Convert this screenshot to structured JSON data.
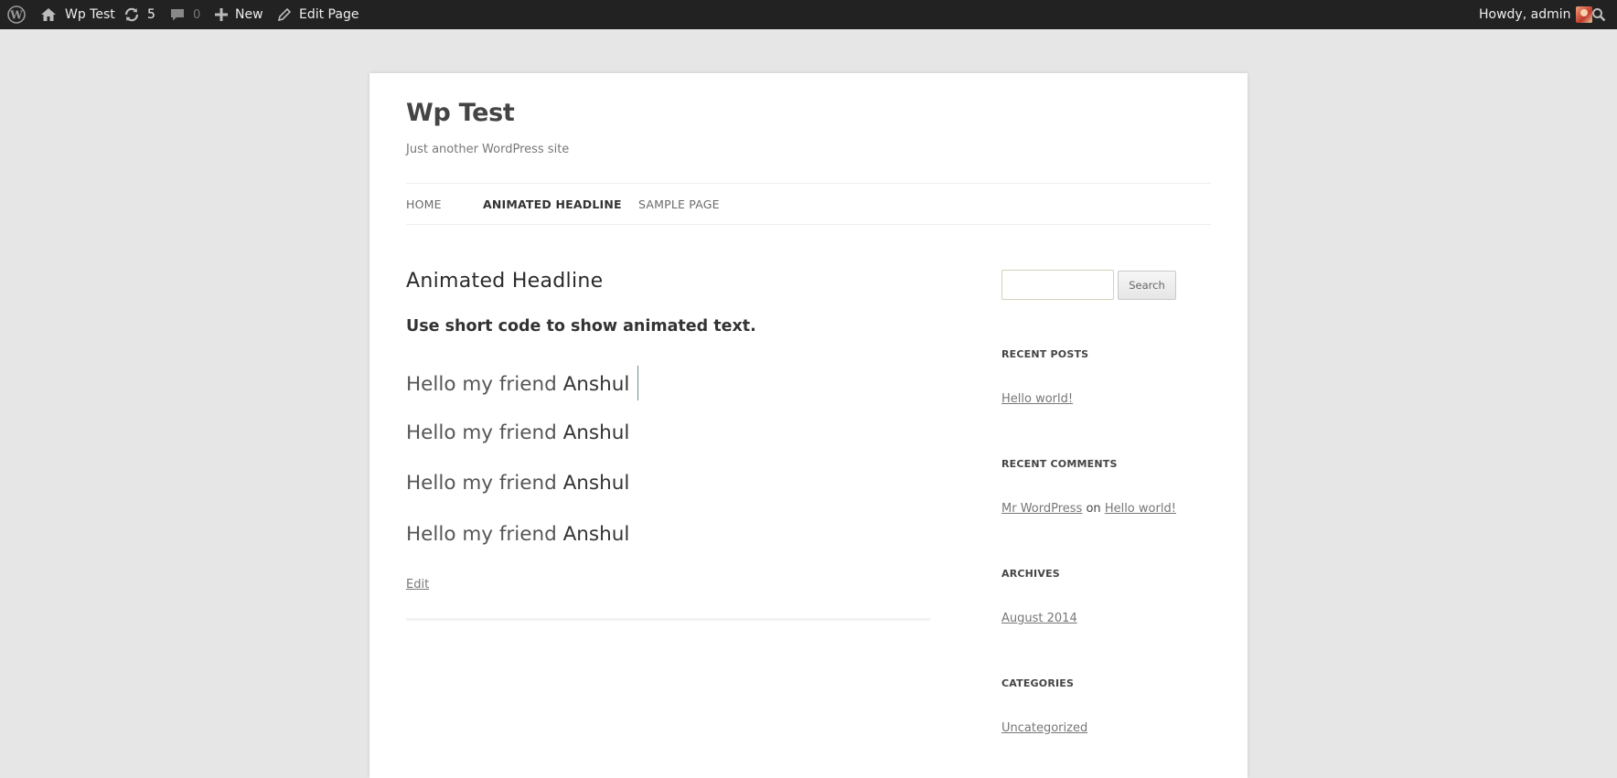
{
  "adminbar": {
    "wp_logo_icon": "wordpress-logo-icon",
    "site_name": "Wp Test",
    "updates_count": "5",
    "comments_count": "0",
    "new_label": "New",
    "edit_label": "Edit Page",
    "howdy": "Howdy, admin"
  },
  "site": {
    "title": "Wp Test",
    "description": "Just another WordPress site"
  },
  "nav": {
    "items": [
      {
        "label": "HOME"
      },
      {
        "label": "ANIMATED HEADLINE"
      },
      {
        "label": "SAMPLE PAGE"
      }
    ]
  },
  "content": {
    "title": "Animated Headline",
    "lead": "Use short code to show animated text.",
    "headlines": [
      {
        "prefix": "Hello my friend",
        "word": "Anshul"
      },
      {
        "prefix": "Hello my friend",
        "word": "Anshul"
      },
      {
        "prefix": "Hello my friend",
        "word": "Anshul"
      },
      {
        "prefix": "Hello my friend",
        "word": "Anshul"
      }
    ],
    "edit_link": "Edit"
  },
  "sidebar": {
    "search": {
      "button": "Search",
      "value": ""
    },
    "recent_posts": {
      "title": "RECENT POSTS",
      "items": [
        "Hello world!"
      ]
    },
    "recent_comments": {
      "title": "RECENT COMMENTS",
      "author": "Mr WordPress",
      "on": "on",
      "post": "Hello world!"
    },
    "archives": {
      "title": "ARCHIVES",
      "items": [
        "August 2014"
      ]
    },
    "categories": {
      "title": "CATEGORIES",
      "items": [
        "Uncategorized"
      ]
    }
  },
  "colors": {
    "adminbar_bg": "#222222",
    "page_bg": "#e6e6e6",
    "content_bg": "#ffffff"
  }
}
